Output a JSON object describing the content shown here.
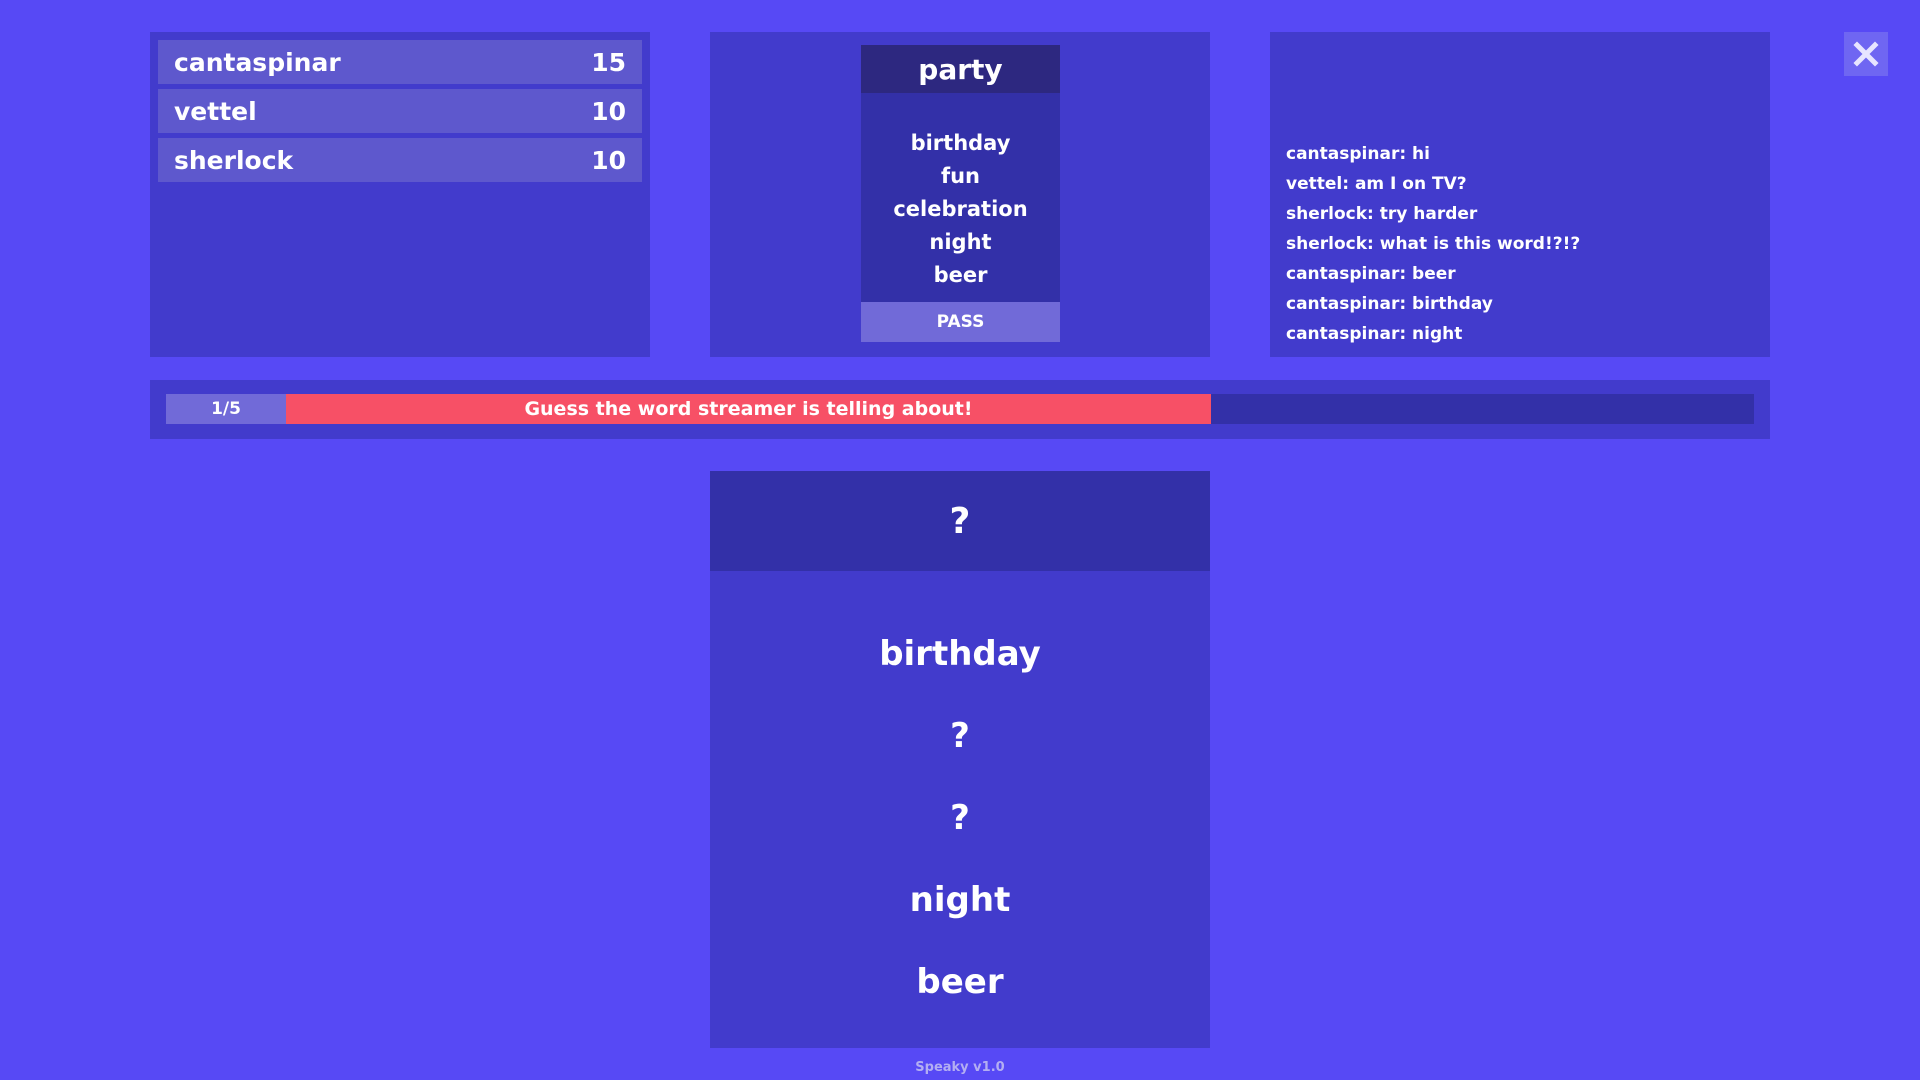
{
  "leaderboard": {
    "players": [
      {
        "name": "cantaspinar",
        "score": "15"
      },
      {
        "name": "vettel",
        "score": "10"
      },
      {
        "name": "sherlock",
        "score": "10"
      }
    ]
  },
  "card": {
    "word": "party",
    "hints": [
      "birthday",
      "fun",
      "celebration",
      "night",
      "beer"
    ],
    "pass_label": "PASS"
  },
  "chat": {
    "messages": [
      "cantaspinar: hi",
      "vettel: am I on TV?",
      "sherlock: try harder",
      "sherlock: what is this word!?!?",
      "cantaspinar: beer",
      "cantaspinar: birthday",
      "cantaspinar: night"
    ]
  },
  "progress": {
    "round": "1/5",
    "message": "Guess the word streamer is telling about!",
    "fraction": 0.63,
    "fill_color": "#f75066"
  },
  "reveal": {
    "hidden_word": "?",
    "hints": [
      "birthday",
      "?",
      "?",
      "night",
      "beer"
    ]
  },
  "close_icon": "close-icon",
  "footer": "Speaky v1.0"
}
